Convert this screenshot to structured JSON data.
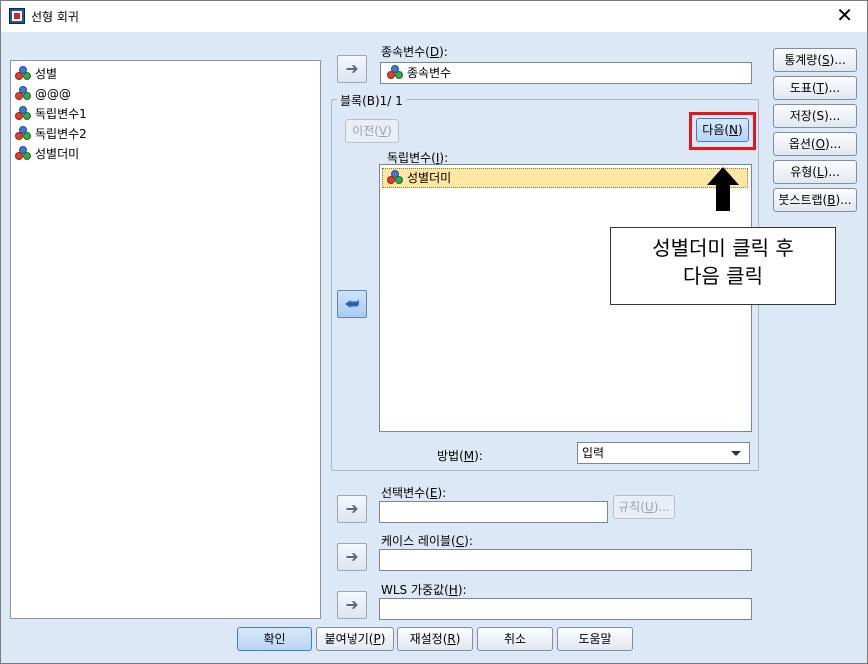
{
  "window": {
    "title": "선형 회귀",
    "close_glyph": "✕"
  },
  "source_list": {
    "items": [
      {
        "label": "성별"
      },
      {
        "label": "@@@"
      },
      {
        "label": "독립변수1"
      },
      {
        "label": "독립변수2"
      },
      {
        "label": "성별더미"
      }
    ]
  },
  "dependent": {
    "label_prefix": "종속변수(",
    "label_key": "D",
    "label_suffix": "):",
    "value": "종속변수"
  },
  "block": {
    "title": "블록(B)1/ 1",
    "prev_prefix": "이전(",
    "prev_key": "V",
    "prev_suffix": ")",
    "next_prefix": "다음(",
    "next_key": "N",
    "next_suffix": ")",
    "indep_label_prefix": "독립변수(",
    "indep_label_key": "I",
    "indep_label_suffix": "):",
    "indep_items": [
      {
        "label": "성별더미"
      }
    ],
    "method_prefix": "방법(",
    "method_key": "M",
    "method_suffix": "):",
    "method_value": "입력"
  },
  "selection": {
    "label_prefix": "선택변수(",
    "label_key": "E",
    "label_suffix": "):",
    "value": "",
    "rule_prefix": "규칙(",
    "rule_key": "U",
    "rule_suffix": ")..."
  },
  "case_label": {
    "label_prefix": "케이스 레이블(",
    "label_key": "C",
    "label_suffix": "):",
    "value": ""
  },
  "wls": {
    "label_prefix": "WLS 가중값(",
    "label_key": "H",
    "label_suffix": "):",
    "value": ""
  },
  "side_buttons": [
    {
      "prefix": "통계량(",
      "key": "S",
      "suffix": ")..."
    },
    {
      "prefix": "도표(",
      "key": "T",
      "suffix": ")..."
    },
    {
      "prefix": "저장(S)...",
      "key": "",
      "suffix": ""
    },
    {
      "prefix": "옵션(",
      "key": "O",
      "suffix": ")..."
    },
    {
      "prefix": "유형(",
      "key": "L",
      "suffix": ")..."
    },
    {
      "prefix": "붓스트랩(",
      "key": "B",
      "suffix": ")..."
    }
  ],
  "bottom_buttons": {
    "ok": "확인",
    "paste_prefix": "붙여넣기(",
    "paste_key": "P",
    "paste_suffix": ")",
    "reset_prefix": "재설정(",
    "reset_key": "R",
    "reset_suffix": ")",
    "cancel": "취소",
    "help": "도움말"
  },
  "annotation": {
    "line1": "성별더미 클릭 후",
    "line2": "다음 클릭",
    "highlight_color": "#e8141c"
  },
  "icons": {
    "variable": "nominal-variable-icon",
    "move_right": "arrow-right-icon",
    "move_left": "arrow-left-icon"
  }
}
